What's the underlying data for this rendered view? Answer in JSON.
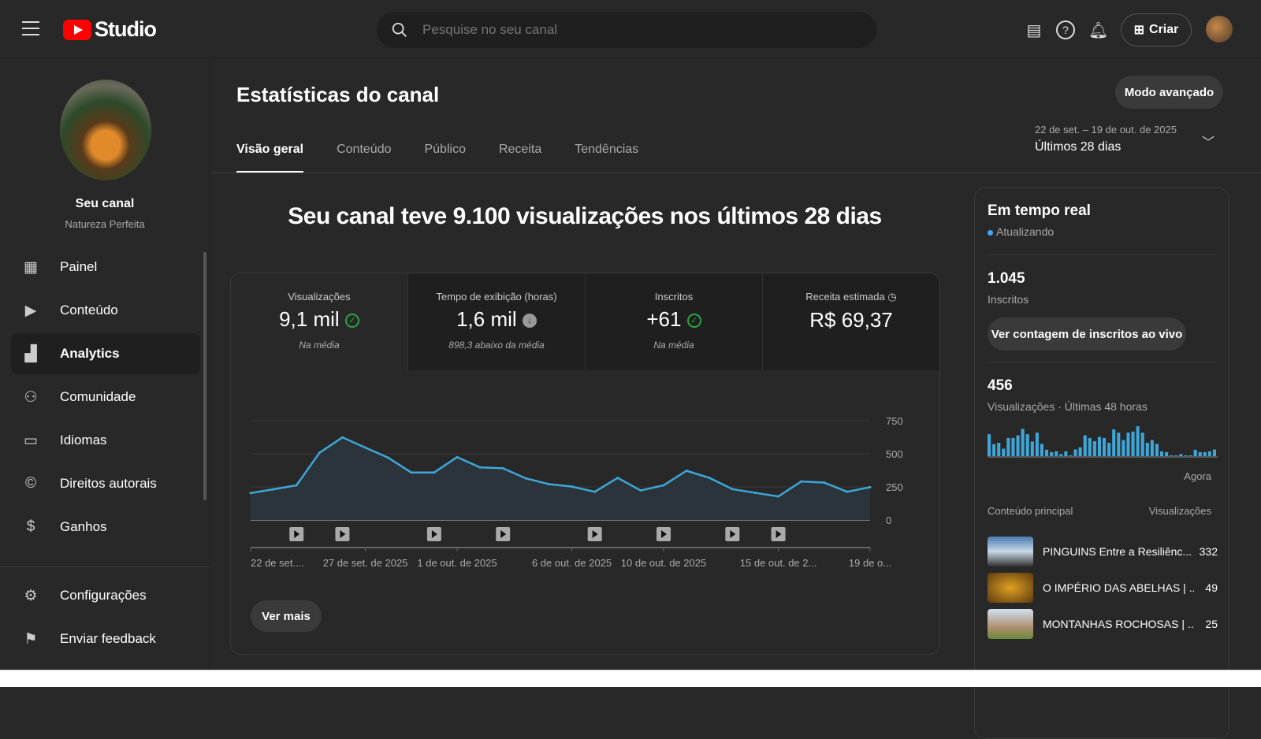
{
  "header": {
    "logo_text": "Studio",
    "search_placeholder": "Pesquise no seu canal",
    "create_label": "Criar"
  },
  "sidebar": {
    "channel_name": "Seu canal",
    "channel_handle": "Natureza Perfeita",
    "items": [
      {
        "label": "Painel",
        "icon": "dashboard-icon"
      },
      {
        "label": "Conteúdo",
        "icon": "content-icon"
      },
      {
        "label": "Analytics",
        "icon": "analytics-icon",
        "active": true
      },
      {
        "label": "Comunidade",
        "icon": "community-icon"
      },
      {
        "label": "Idiomas",
        "icon": "subtitles-icon"
      },
      {
        "label": "Direitos autorais",
        "icon": "copyright-icon"
      },
      {
        "label": "Ganhos",
        "icon": "dollar-icon"
      }
    ],
    "footer": [
      {
        "label": "Configurações",
        "icon": "gear-icon"
      },
      {
        "label": "Enviar feedback",
        "icon": "feedback-icon"
      }
    ]
  },
  "page": {
    "title": "Estatísticas do canal",
    "advanced_mode": "Modo avançado",
    "tabs": [
      "Visão geral",
      "Conteúdo",
      "Público",
      "Receita",
      "Tendências"
    ],
    "date_range": "22 de set. – 19 de out. de 2025",
    "date_label": "Últimos 28 dias",
    "headline": "Seu canal teve 9.100 visualizações nos últimos 28 dias",
    "metrics": [
      {
        "title": "Visualizações",
        "value": "9,1 mil",
        "note": "Na média",
        "status": "ok"
      },
      {
        "title": "Tempo de exibição (horas)",
        "value": "1,6 mil",
        "note": "898,3 abaixo da média",
        "status": "down"
      },
      {
        "title": "Inscritos",
        "value": "+61",
        "note": "Na média",
        "status": "ok"
      },
      {
        "title": "Receita estimada",
        "value": "R$ 69,37",
        "note": "",
        "status": "clock"
      }
    ],
    "see_more": "Ver mais"
  },
  "chart_data": {
    "type": "area",
    "series": [
      {
        "name": "Visualizações",
        "values": [
          203,
          232,
          262,
          508,
          624,
          547,
          470,
          359,
          359,
          475,
          397,
          391,
          314,
          271,
          252,
          213,
          318,
          223,
          262,
          372,
          318,
          233,
          205,
          178,
          291,
          283,
          213,
          248
        ]
      }
    ],
    "video_markers": [
      2,
      4,
      8,
      11,
      15,
      18,
      21,
      23
    ],
    "ylim": [
      0,
      750
    ],
    "yticks": [
      "0",
      "250",
      "500",
      "750"
    ],
    "xticks": [
      {
        "i": 0,
        "label": "22 de set...."
      },
      {
        "i": 5,
        "label": "27 de set. de 2025"
      },
      {
        "i": 9,
        "label": "1 de out. de 2025"
      },
      {
        "i": 14,
        "label": "6 de out. de 2025"
      },
      {
        "i": 18,
        "label": "10 de out. de 2025"
      },
      {
        "i": 23,
        "label": "15 de out. de 2..."
      },
      {
        "i": 27,
        "label": "19 de o..."
      }
    ],
    "color": "#3ea6d8"
  },
  "realtime": {
    "title": "Em tempo real",
    "status": "Atualizando",
    "subs": "1.045",
    "subs_label": "Inscritos",
    "live_button": "Ver contagem de inscritos ao vivo",
    "views": "456",
    "views_label": "Visualizações · Últimas 48 horas",
    "now_label": "Agora",
    "bars": [
      82,
      45,
      50,
      28,
      68,
      68,
      78,
      102,
      82,
      55,
      88,
      46,
      24,
      15,
      18,
      8,
      18,
      3,
      25,
      33,
      78,
      68,
      56,
      72,
      68,
      50,
      100,
      88,
      60,
      88,
      92,
      112,
      88,
      50,
      60,
      46,
      18,
      15,
      3,
      3,
      8,
      1,
      3,
      24,
      15,
      15,
      18,
      25
    ],
    "top_header": "Conteúdo principal",
    "top_views_header": "Visualizações",
    "top": [
      {
        "title": "PINGUINS Entre a Resiliênc...",
        "views": "332"
      },
      {
        "title": "O IMPÉRIO DAS ABELHAS | ...",
        "views": "49"
      },
      {
        "title": "MONTANHAS ROCHOSAS | ...",
        "views": "25"
      }
    ]
  }
}
